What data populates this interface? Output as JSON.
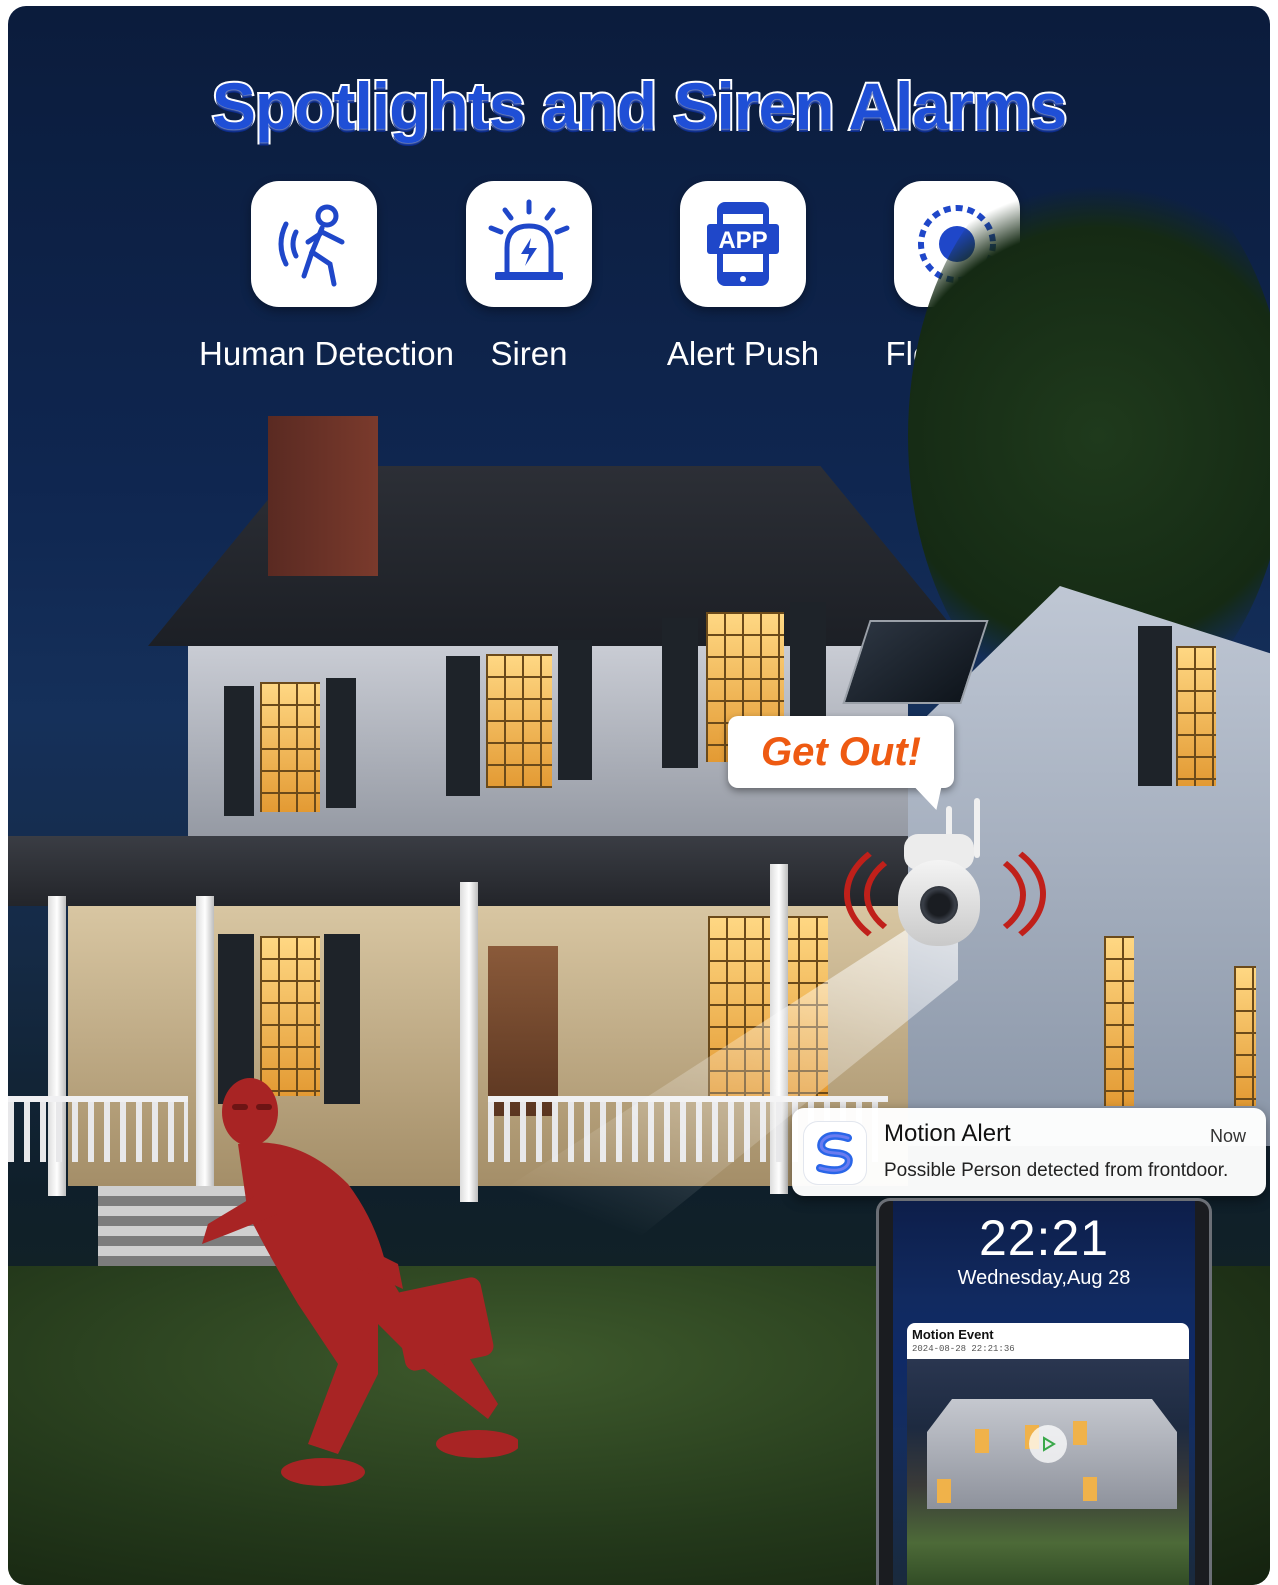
{
  "header": {
    "title": "Spotlights and Siren Alarms"
  },
  "features": [
    {
      "label": "Human Detection",
      "icon": "human-motion-icon"
    },
    {
      "label": "Siren",
      "icon": "siren-icon"
    },
    {
      "label": "Alert Push",
      "icon": "app-phone-icon",
      "icon_text": "APP"
    },
    {
      "label": "Floodlight",
      "icon": "floodlight-icon"
    }
  ],
  "speech_bubble": {
    "text": "Get Out!"
  },
  "notification": {
    "title": "Motion Alert",
    "time": "Now",
    "body": "Possible Person detected from frontdoor.",
    "app_icon": "app-logo-icon"
  },
  "phone": {
    "time": "22:21",
    "date": "Wednesday,Aug 28",
    "event": {
      "title": "Motion Event",
      "timestamp": "2024-08-28 22:21:36"
    }
  },
  "colors": {
    "title_blue": "#1f4fd6",
    "icon_blue": "#1f47c9",
    "bubble_orange": "#ee5a12",
    "siren_red": "#c0201a"
  }
}
